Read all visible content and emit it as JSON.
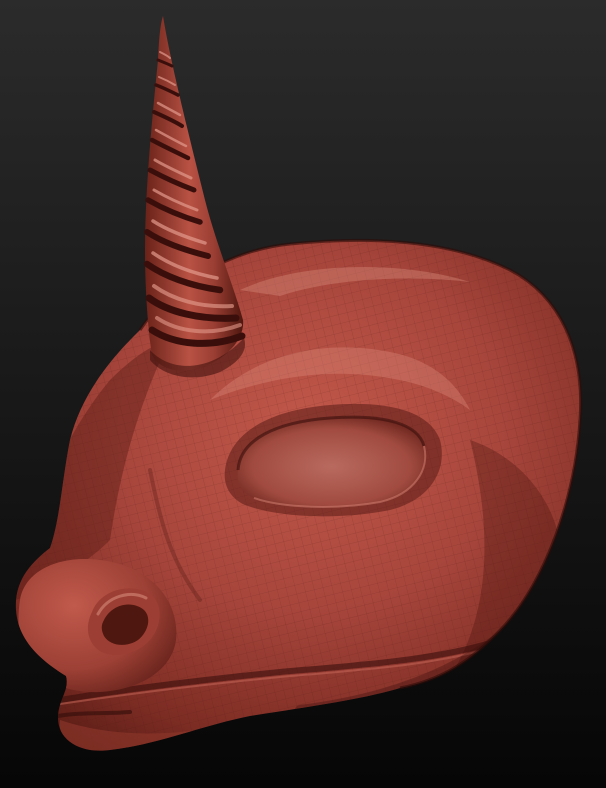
{
  "scene": {
    "subject": "sculpted-unicorn-head",
    "background": {
      "top": "#2b2b2b",
      "bottom": "#060606"
    },
    "material": {
      "base": "#a8463c",
      "shadow": "#5a1c16",
      "deep_shadow": "#3a0f0b",
      "highlight": "#d98678",
      "wire": "#6b241c"
    }
  }
}
